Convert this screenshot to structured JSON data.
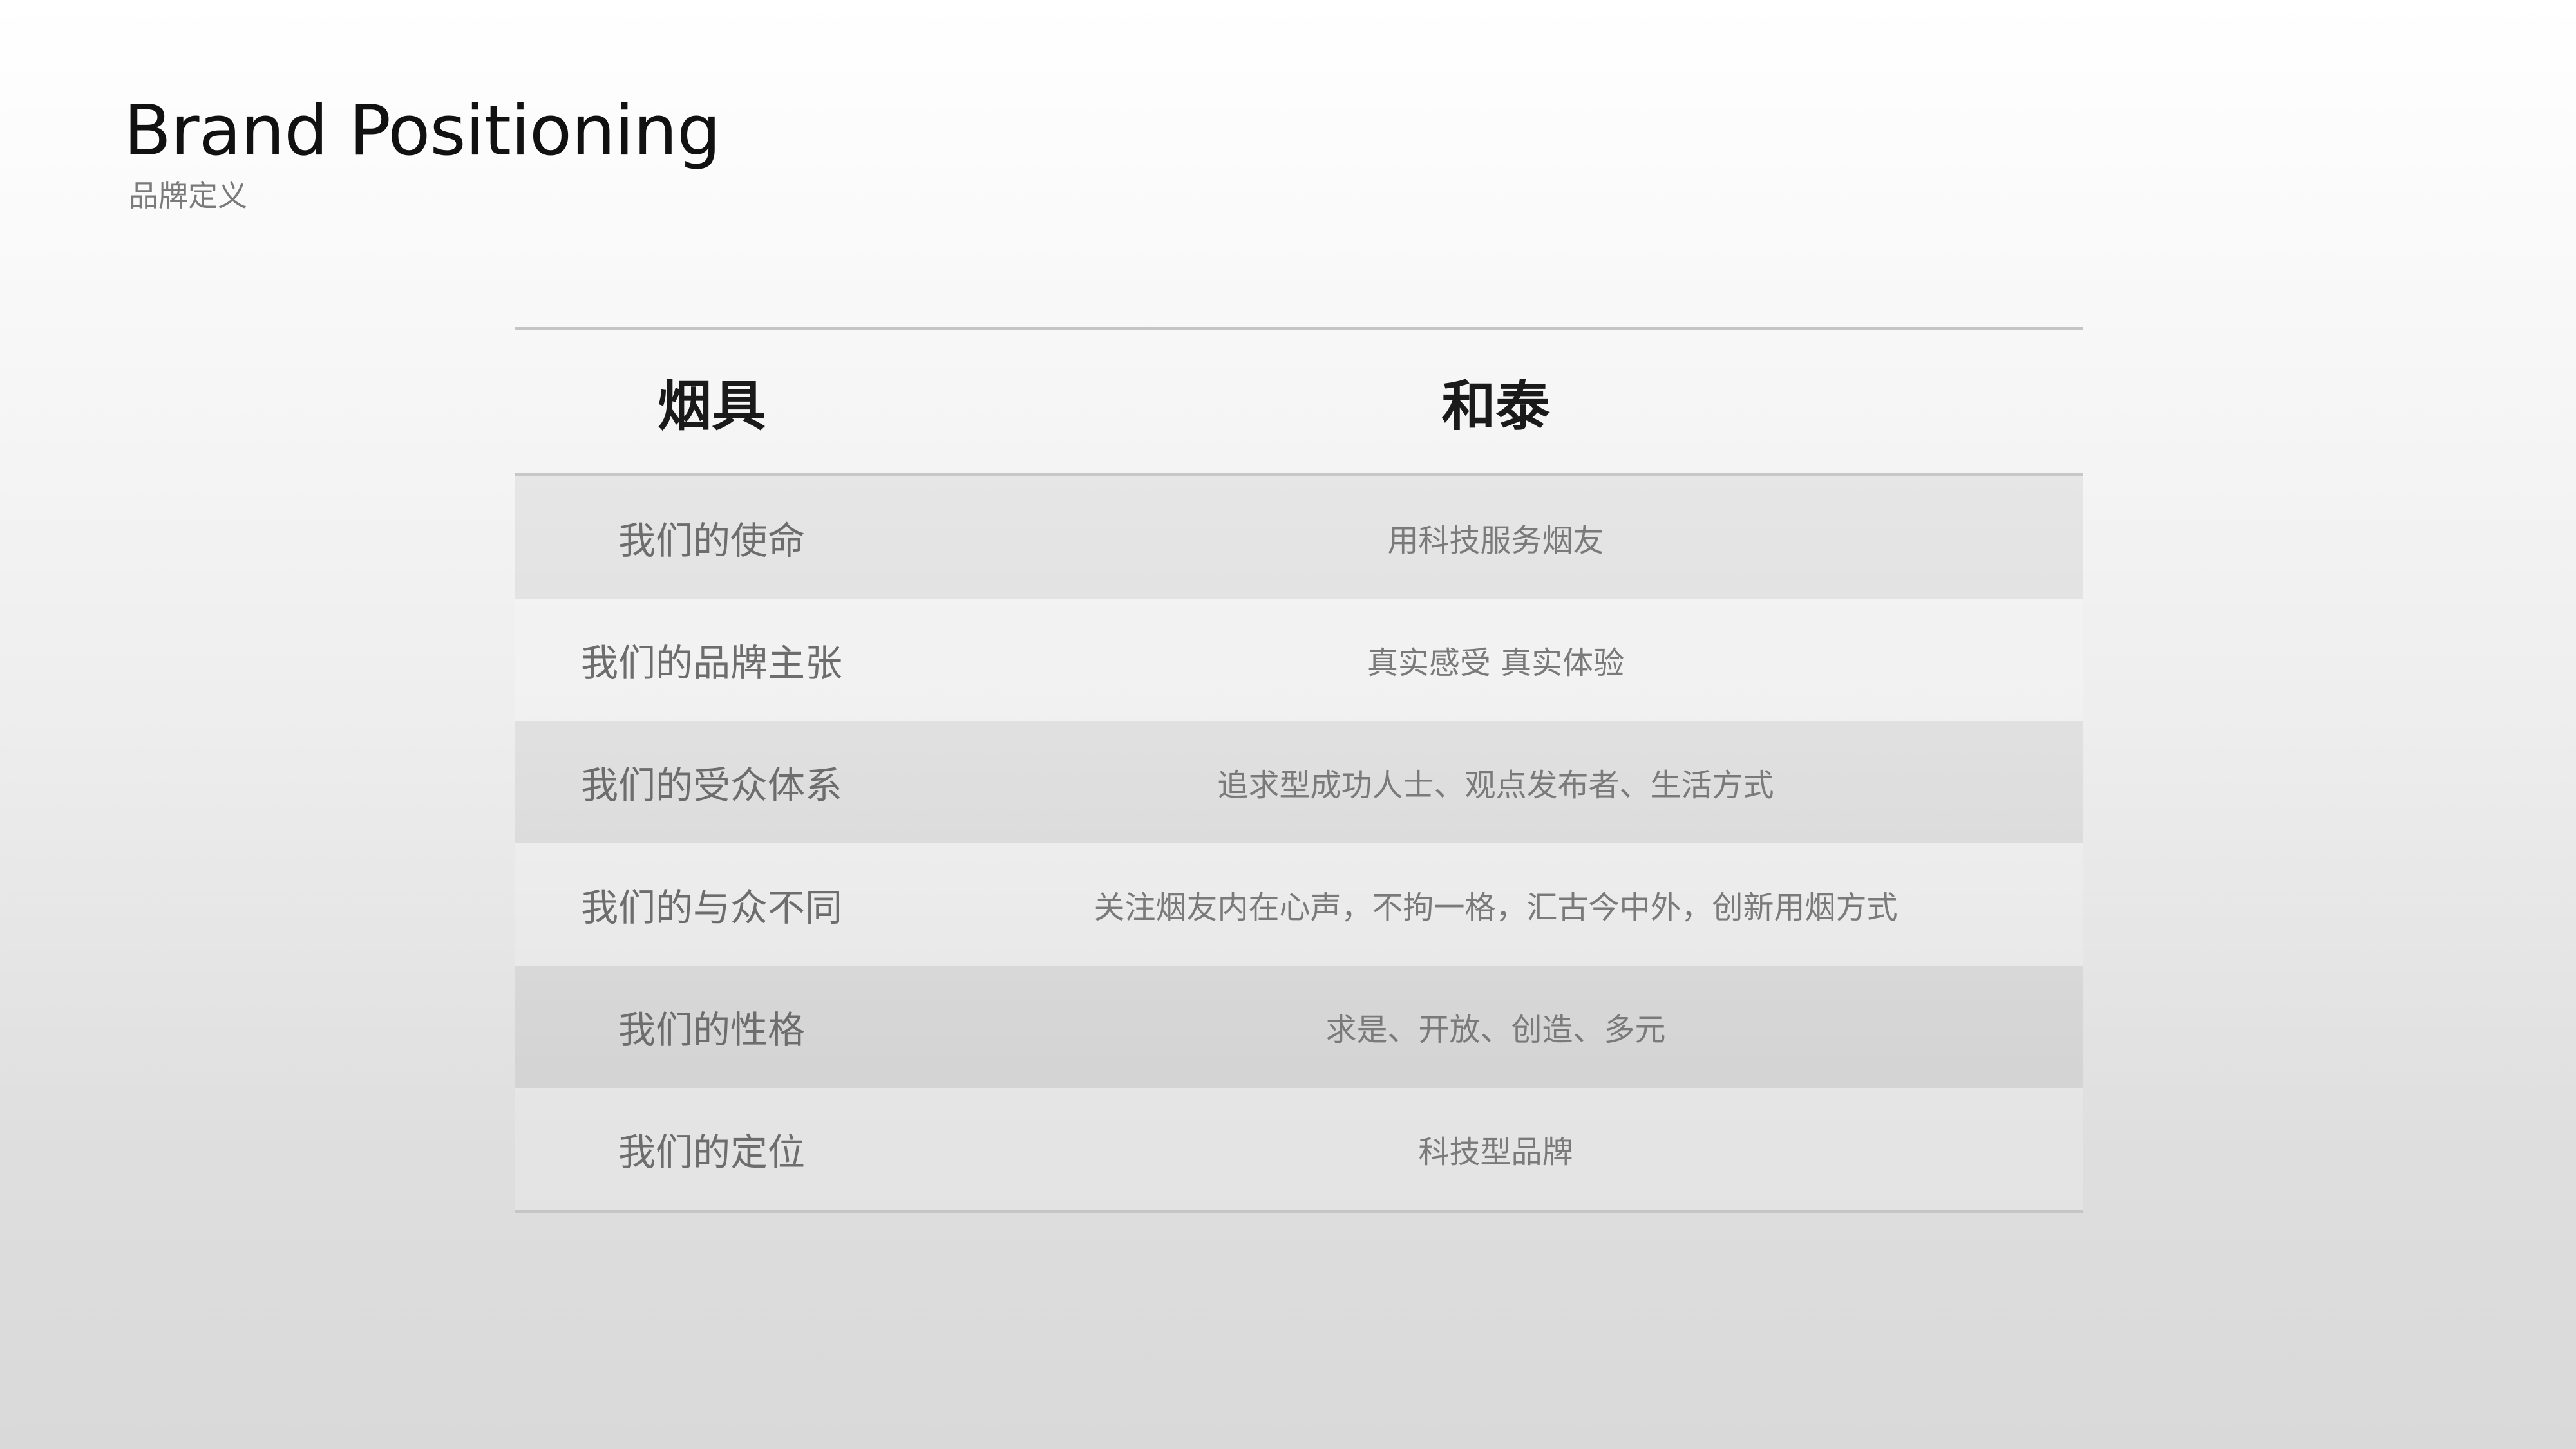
{
  "slide": {
    "title": "Brand Positioning",
    "subtitle": "品牌定义"
  },
  "table": {
    "headers": [
      "烟具",
      "和泰"
    ],
    "rows": [
      {
        "label": "我们的使命",
        "value": "用科技服务烟友"
      },
      {
        "label": "我们的品牌主张",
        "value": "真实感受 真实体验"
      },
      {
        "label": "我们的受众体系",
        "value": "追求型成功人士、观点发布者、生活方式"
      },
      {
        "label": "我们的与众不同",
        "value": "关注烟友内在心声，不拘一格，汇古今中外，创新用烟方式"
      },
      {
        "label": "我们的性格",
        "value": "求是、开放、创造、多元"
      },
      {
        "label": "我们的定位",
        "value": "科技型品牌"
      }
    ]
  }
}
